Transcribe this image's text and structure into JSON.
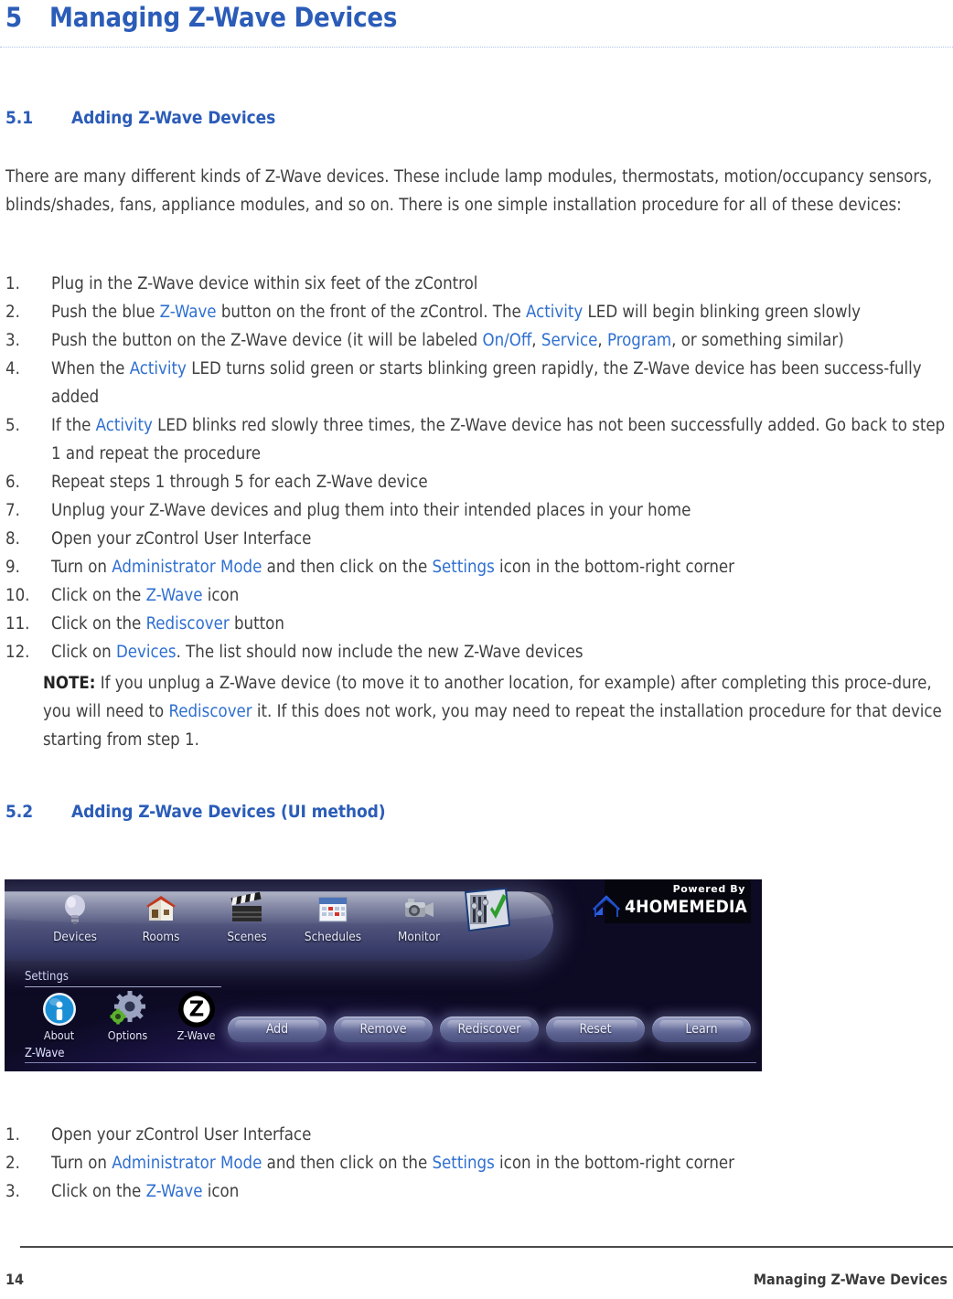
{
  "chapter": {
    "number": "5",
    "title": "Managing Z-Wave Devices",
    "color": "#2b5cb8"
  },
  "sections": {
    "s51": {
      "number": "5.1",
      "title": "Adding Z-Wave Devices"
    },
    "s52": {
      "number": "5.2",
      "title": "Adding Z-Wave Devices (UI method)"
    }
  },
  "intro_paragraph": "There are many different kinds of Z-Wave devices. These include lamp modules, thermostats, motion/occupancy sensors, blinds/shades, fans, appliance modules, and so on. There is one simple installation procedure for all of these devices:",
  "steps_main": [
    {
      "num": "1.",
      "parts": [
        {
          "t": "Plug in the Z-Wave device within six feet  of the zControl"
        }
      ]
    },
    {
      "num": "2.",
      "parts": [
        {
          "t": "Push the blue "
        },
        {
          "t": "Z-Wave",
          "hl": true
        },
        {
          "t": " button on the front of the zControl. The "
        },
        {
          "t": "Activity",
          "hl": true
        },
        {
          "t": " LED will begin blinking green slowly"
        }
      ]
    },
    {
      "num": "3.",
      "parts": [
        {
          "t": "Push the button on the Z-Wave device (it will be labeled "
        },
        {
          "t": "On/Off",
          "hl": true
        },
        {
          "t": ", "
        },
        {
          "t": "Service",
          "hl": true
        },
        {
          "t": ", "
        },
        {
          "t": "Program",
          "hl": true
        },
        {
          "t": ", or something similar)"
        }
      ]
    },
    {
      "num": "4.",
      "parts": [
        {
          "t": "When the "
        },
        {
          "t": "Activity",
          "hl": true
        },
        {
          "t": " LED turns solid green or starts blinking green rapidly, the Z-Wave device has been success-fully added"
        }
      ]
    },
    {
      "num": "5.",
      "parts": [
        {
          "t": "If the "
        },
        {
          "t": "Activity",
          "hl": true
        },
        {
          "t": " LED blinks red slowly three times, the Z-Wave device has not been successfully added. Go back to step 1 and repeat the procedure"
        }
      ]
    },
    {
      "num": "6.",
      "parts": [
        {
          "t": "Repeat steps 1 through 5 for each Z-Wave device"
        }
      ]
    },
    {
      "num": "7.",
      "parts": [
        {
          "t": "Unplug your Z-Wave devices and plug them into their intended places in your home"
        }
      ]
    },
    {
      "num": "8.",
      "parts": [
        {
          "t": "Open your zControl User Interface"
        }
      ]
    },
    {
      "num": "9.",
      "parts": [
        {
          "t": "Turn on "
        },
        {
          "t": "Administrator Mode",
          "hl": true
        },
        {
          "t": " and then click on the "
        },
        {
          "t": "Settings",
          "hl": true
        },
        {
          "t": " icon in the bottom-right corner"
        }
      ]
    },
    {
      "num": "10.",
      "parts": [
        {
          "t": "Click on the "
        },
        {
          "t": "Z-Wave",
          "hl": true
        },
        {
          "t": " icon"
        }
      ]
    },
    {
      "num": "11.",
      "parts": [
        {
          "t": "Click on the "
        },
        {
          "t": "Rediscover",
          "hl": true
        },
        {
          "t": " button"
        }
      ]
    },
    {
      "num": "12.",
      "parts": [
        {
          "t": "Click on "
        },
        {
          "t": "Devices",
          "hl": true
        },
        {
          "t": ". The list should now include the new Z-Wave devices"
        }
      ]
    }
  ],
  "note": {
    "label": "NOTE:",
    "parts": [
      {
        "t": " If you unplug a Z-Wave device (to move it to another location, for example) after completing this proce-dure, you will need to "
      },
      {
        "t": "Rediscover",
        "hl": true
      },
      {
        "t": " it.  If this does not work, you may need to repeat the installation procedure for that device starting from step 1."
      }
    ]
  },
  "steps_ui": [
    {
      "num": "1.",
      "parts": [
        {
          "t": "Open your zControl User Interface"
        }
      ]
    },
    {
      "num": "2.",
      "parts": [
        {
          "t": "Turn on "
        },
        {
          "t": "Administrator Mode",
          "hl": true
        },
        {
          "t": " and then click on the "
        },
        {
          "t": "Settings",
          "hl": true
        },
        {
          "t": " icon in the bottom-right corner"
        }
      ]
    },
    {
      "num": "3.",
      "parts": [
        {
          "t": "Click on the "
        },
        {
          "t": "Z-Wave",
          "hl": true
        },
        {
          "t": " icon"
        }
      ]
    }
  ],
  "screenshot": {
    "nav_items": [
      {
        "label": "Devices",
        "icon": "lightbulb-icon"
      },
      {
        "label": "Rooms",
        "icon": "house-icon"
      },
      {
        "label": "Scenes",
        "icon": "clapperboard-icon"
      },
      {
        "label": "Schedules",
        "icon": "calendar-icon"
      },
      {
        "label": "Monitor",
        "icon": "camera-icon"
      }
    ],
    "settings_tile_icon": "settings-panel-check-icon",
    "logo": {
      "powered_by": "Powered By",
      "brand_4": "4",
      "brand_home": "H",
      "brand_home_rest": "OME",
      "brand_media": "M",
      "brand_media_rest": "EDIA",
      "full": "4HOMEMEDIA"
    },
    "settings_label": "Settings",
    "settings_items": [
      {
        "label": "About",
        "icon": "info-icon"
      },
      {
        "label": "Options",
        "icon": "gear-icon"
      },
      {
        "label": "Z-Wave",
        "icon": "zwave-icon"
      }
    ],
    "zwave_label": "Z-Wave",
    "buttons": [
      "Add",
      "Remove",
      "Rediscover",
      "Reset",
      "Learn"
    ]
  },
  "footer": {
    "page_number": "14",
    "running_title": "Managing Z-Wave Devices"
  }
}
